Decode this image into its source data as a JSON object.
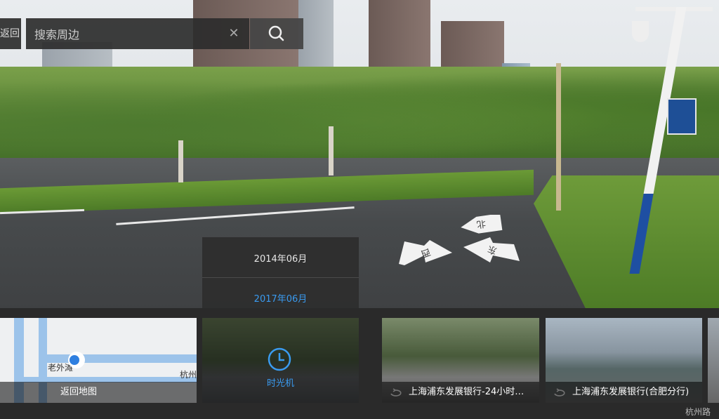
{
  "search": {
    "back_label": "返回",
    "placeholder": "搜索周边",
    "clear_icon": "close-icon",
    "search_icon": "search-icon"
  },
  "directions": {
    "north": "北",
    "west": "西",
    "east": "东"
  },
  "time_machine": {
    "dates": [
      "2014年06月",
      "2017年06月"
    ],
    "selected_index": 1,
    "selected_color": "#3a9bf0",
    "label": "时光机"
  },
  "map_thumb": {
    "label": "返回地图",
    "street_1": "老外滩",
    "street_2": "杭州"
  },
  "panoramas": [
    {
      "title": "上海浦东发展银行-24小时…"
    },
    {
      "title": "上海浦东发展银行(合肥分行)"
    }
  ],
  "current_road": "杭州路"
}
